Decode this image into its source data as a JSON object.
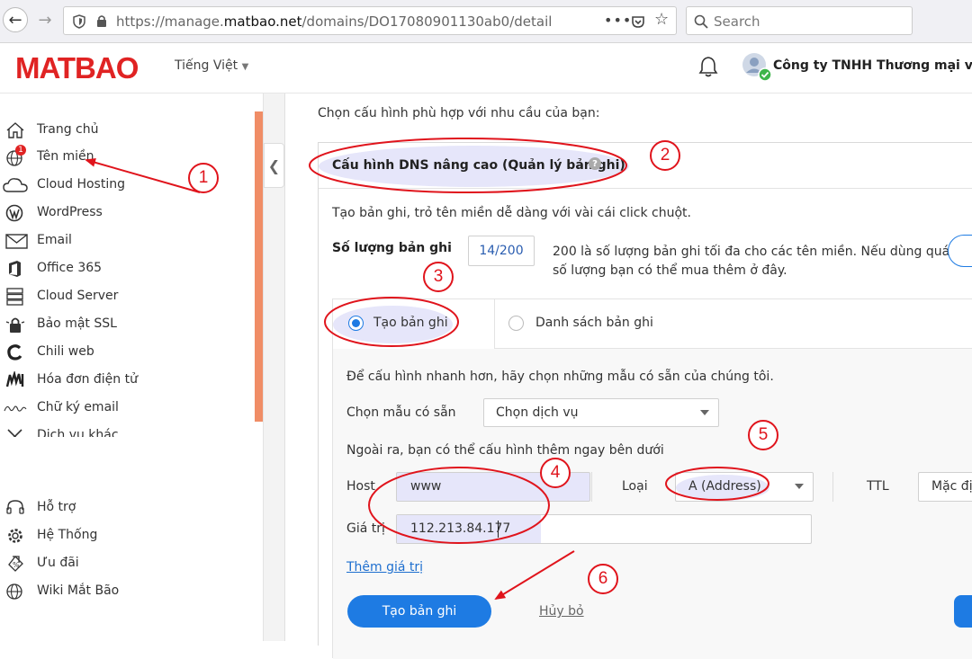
{
  "browser": {
    "url_prefix": "https://manage.",
    "url_domain": "matbao.net",
    "url_suffix": "/domains/DO17080901130ab0/detail",
    "search_placeholder": "Search",
    "more_icon": "more-horizontal-icon"
  },
  "header": {
    "logo": "MATBAO",
    "language": "Tiếng Việt",
    "company": "Công ty TNHH Thương mại và Sả"
  },
  "sidebar": {
    "items": [
      {
        "label": "Trang chủ",
        "icon": "home-icon"
      },
      {
        "label": "Tên miền",
        "icon": "globe-icon",
        "badge": "1"
      },
      {
        "label": "Cloud Hosting",
        "icon": "cloud-icon"
      },
      {
        "label": "WordPress",
        "icon": "wordpress-icon"
      },
      {
        "label": "Email",
        "icon": "mail-icon"
      },
      {
        "label": "Office 365",
        "icon": "office-icon"
      },
      {
        "label": "Cloud Server",
        "icon": "server-icon"
      },
      {
        "label": "Bảo mật SSL",
        "icon": "ssl-lock-icon"
      },
      {
        "label": "Chili web",
        "icon": "chili-icon"
      },
      {
        "label": "Hóa đơn điện tử",
        "icon": "invoice-icon"
      },
      {
        "label": "Chữ ký email",
        "icon": "signature-icon"
      },
      {
        "label": "Dịch vụ khác",
        "icon": "tools-icon"
      }
    ],
    "bottom_items": [
      {
        "label": "Hỗ trợ",
        "icon": "headset-icon"
      },
      {
        "label": "Hệ Thống",
        "icon": "gear-icon"
      },
      {
        "label": "Ưu đãi",
        "icon": "discount-icon"
      },
      {
        "label": "Wiki Mắt Bão",
        "icon": "wiki-globe-icon"
      }
    ]
  },
  "main": {
    "intro": "Chọn cấu hình phù hợp với nhu cầu của bạn:",
    "panel_title": "Cấu hình DNS nâng cao (Quản lý bản ghi)",
    "panel_desc": "Tạo bản ghi, trỏ tên miền dễ dàng với vài cái click chuột.",
    "record_count_label": "Số lượng bản ghi",
    "record_count_value": "14/200",
    "record_count_help_line1": "200 là số lượng bản ghi tối đa cho các tên miền. Nếu dùng quá",
    "record_count_help_line2": "số lượng bạn có thể mua thêm ở đây.",
    "tab_create": "Tạo bản ghi",
    "tab_list": "Danh sách bản ghi",
    "template_hint": "Để cấu hình nhanh hơn, hãy chọn những mẫu có sẵn của chúng tôi.",
    "template_label": "Chọn mẫu có sẵn",
    "template_value": "Chọn dịch vụ",
    "extra_hint": "Ngoài ra, bạn có thể cấu hình thêm ngay bên dưới",
    "host_label": "Host",
    "host_value": "www",
    "type_label": "Loại",
    "type_value": "A (Address)",
    "ttl_label": "TTL",
    "ttl_value": "Mặc định",
    "value_label": "Giá trị",
    "value_value": "112.213.84.177",
    "add_value_link": "Thêm giá trị",
    "submit_button": "Tạo bản ghi",
    "cancel_link": "Hủy bỏ"
  },
  "annotations": [
    "1",
    "2",
    "3",
    "4",
    "5",
    "6"
  ],
  "colors": {
    "brand_red": "#e02323",
    "accent_blue": "#1e7be3",
    "annotation_red": "#e0141c",
    "highlight": "#e6e6fa",
    "sidebar_scroll": "#f08d66"
  }
}
